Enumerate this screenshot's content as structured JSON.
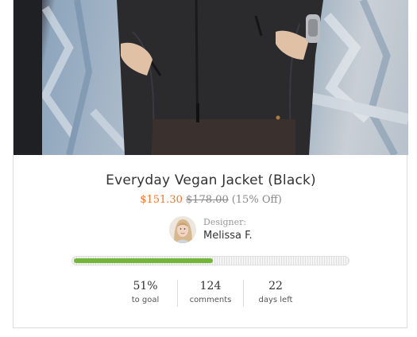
{
  "product": {
    "title": "Everyday Vegan Jacket (Black)",
    "price_sale": "$151.30",
    "price_original": "$178.00",
    "discount": "(15% Off)",
    "image_alt": "Person wearing black vegan jacket in front of graffiti wall"
  },
  "designer": {
    "label": "Designer:",
    "name": "Melissa F."
  },
  "funding": {
    "progress_fraction": 0.51,
    "progress_color": "#72b73a"
  },
  "stats": [
    {
      "value": "51%",
      "label": "to goal"
    },
    {
      "value": "124",
      "label": "comments"
    },
    {
      "value": "22",
      "label": "days left"
    }
  ],
  "colors": {
    "accent_price": "#e8772e",
    "progress": "#72b73a"
  }
}
